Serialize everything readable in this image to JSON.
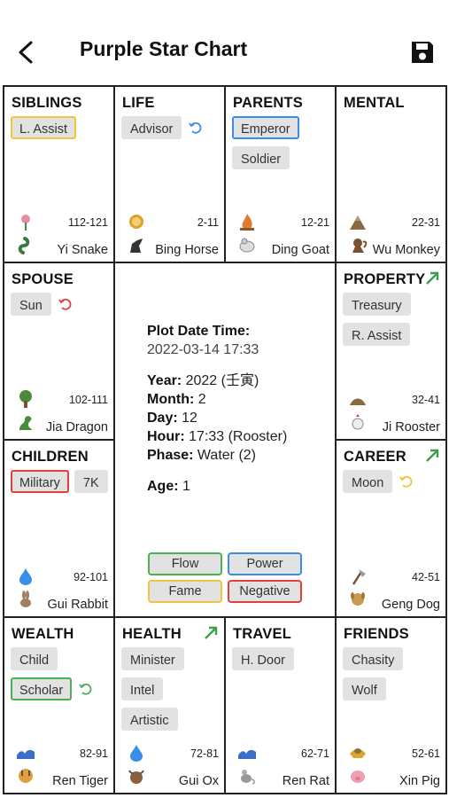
{
  "header": {
    "title": "Purple Star Chart",
    "back_icon": "chevron-left-icon",
    "save_icon": "floppy-disk-icon"
  },
  "palaces": {
    "siblings": {
      "title": "SIBLINGS",
      "stars": [
        "L. Assist"
      ],
      "range": "112-121",
      "branch": "Yi Snake"
    },
    "life": {
      "title": "LIFE",
      "stars": [
        "Advisor"
      ],
      "range": "2-11",
      "branch": "Bing Horse"
    },
    "parents": {
      "title": "PARENTS",
      "stars": [
        "Emperor",
        "Soldier"
      ],
      "range": "12-21",
      "branch": "Ding Goat"
    },
    "mental": {
      "title": "MENTAL",
      "stars": [],
      "range": "22-31",
      "branch": "Wu Monkey"
    },
    "spouse": {
      "title": "SPOUSE",
      "stars": [
        "Sun"
      ],
      "range": "102-111",
      "branch": "Jia Dragon"
    },
    "property": {
      "title": "PROPERTY",
      "stars": [
        "Treasury",
        "R. Assist"
      ],
      "range": "32-41",
      "branch": "Ji Rooster"
    },
    "children": {
      "title": "CHILDREN",
      "stars": [
        "Military",
        "7K"
      ],
      "range": "92-101",
      "branch": "Gui Rabbit"
    },
    "career": {
      "title": "CAREER",
      "stars": [
        "Moon"
      ],
      "range": "42-51",
      "branch": "Geng Dog"
    },
    "wealth": {
      "title": "WEALTH",
      "stars": [
        "Child",
        "Scholar"
      ],
      "range": "82-91",
      "branch": "Ren Tiger"
    },
    "health": {
      "title": "HEALTH",
      "stars": [
        "Minister",
        "Intel",
        "Artistic"
      ],
      "range": "72-81",
      "branch": "Gui Ox"
    },
    "travel": {
      "title": "TRAVEL",
      "stars": [
        "H. Door"
      ],
      "range": "62-71",
      "branch": "Ren Rat"
    },
    "friends": {
      "title": "FRIENDS",
      "stars": [
        "Chasity",
        "Wolf"
      ],
      "range": "52-61",
      "branch": "Xin Pig"
    }
  },
  "center": {
    "plot_label": "Plot Date Time:",
    "plot_value": "2022-03-14 17:33",
    "year_label": "Year:",
    "year_value": "2022 (壬寅)",
    "month_label": "Month:",
    "month_value": "2",
    "day_label": "Day:",
    "day_value": "12",
    "hour_label": "Hour:",
    "hour_value": "17:33 (Rooster)",
    "phase_label": "Phase:",
    "phase_value": "Water (2)",
    "age_label": "Age:",
    "age_value": "1"
  },
  "legend": {
    "flow": "Flow",
    "power": "Power",
    "fame": "Fame",
    "negative": "Negative"
  },
  "colors": {
    "flow": "#4caf50",
    "power": "#3a8ee8",
    "fame": "#f0c341",
    "negative": "#e0403a"
  }
}
